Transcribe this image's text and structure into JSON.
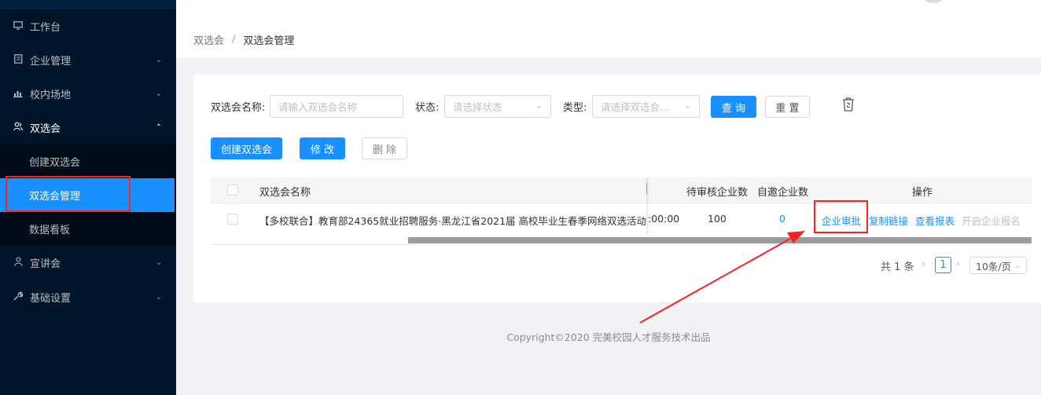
{
  "sidebar": {
    "items": [
      {
        "label": "工作台",
        "icon": "monitor-icon"
      },
      {
        "label": "企业管理",
        "icon": "document-icon"
      },
      {
        "label": "校内场地",
        "icon": "bar-chart-icon"
      },
      {
        "label": "双选会",
        "icon": "users-icon"
      },
      {
        "label": "宣讲会",
        "icon": "user-icon"
      },
      {
        "label": "基础设置",
        "icon": "wrench-icon"
      }
    ],
    "submenu": [
      {
        "label": "创建双选会"
      },
      {
        "label": "双选会管理"
      },
      {
        "label": "数据看板"
      }
    ]
  },
  "breadcrumb": {
    "parent": "双选会",
    "separator": "/",
    "current": "双选会管理"
  },
  "filters": {
    "name_label": "双选会名称:",
    "name_placeholder": "请输入双选会名称",
    "status_label": "状态:",
    "status_placeholder": "请选择状态",
    "type_label": "类型:",
    "type_placeholder": "请选择双选会..."
  },
  "buttons": {
    "query": "查 询",
    "reset": "重 置",
    "create": "创建双选会",
    "edit": "修 改",
    "delete": "删 除"
  },
  "table": {
    "headers": {
      "name": "双选会名称",
      "pending": "待审核企业数",
      "invited": "自邀企业数",
      "actions": "操作"
    },
    "rows": [
      {
        "name": "【多校联合】教育部24365就业招聘服务·黑龙江省2021届 高校毕业生春季网络双选活动",
        "time_fragment": ":00:00",
        "pending": "100",
        "invited": "0",
        "actions": {
          "approve": "企业审批",
          "copy_link": "复制链接",
          "view_report": "查看报表",
          "open_signup": "开启企业报名"
        }
      }
    ]
  },
  "pagination": {
    "total": "共 1 条",
    "current_page": "1",
    "page_size": "10条/页"
  },
  "footer": "Copyright©2020 完美校园人才服务技术出品",
  "colors": {
    "primary": "#1890ff",
    "sidebar_bg": "#001529",
    "annotation_red": "#ff1f1f"
  }
}
